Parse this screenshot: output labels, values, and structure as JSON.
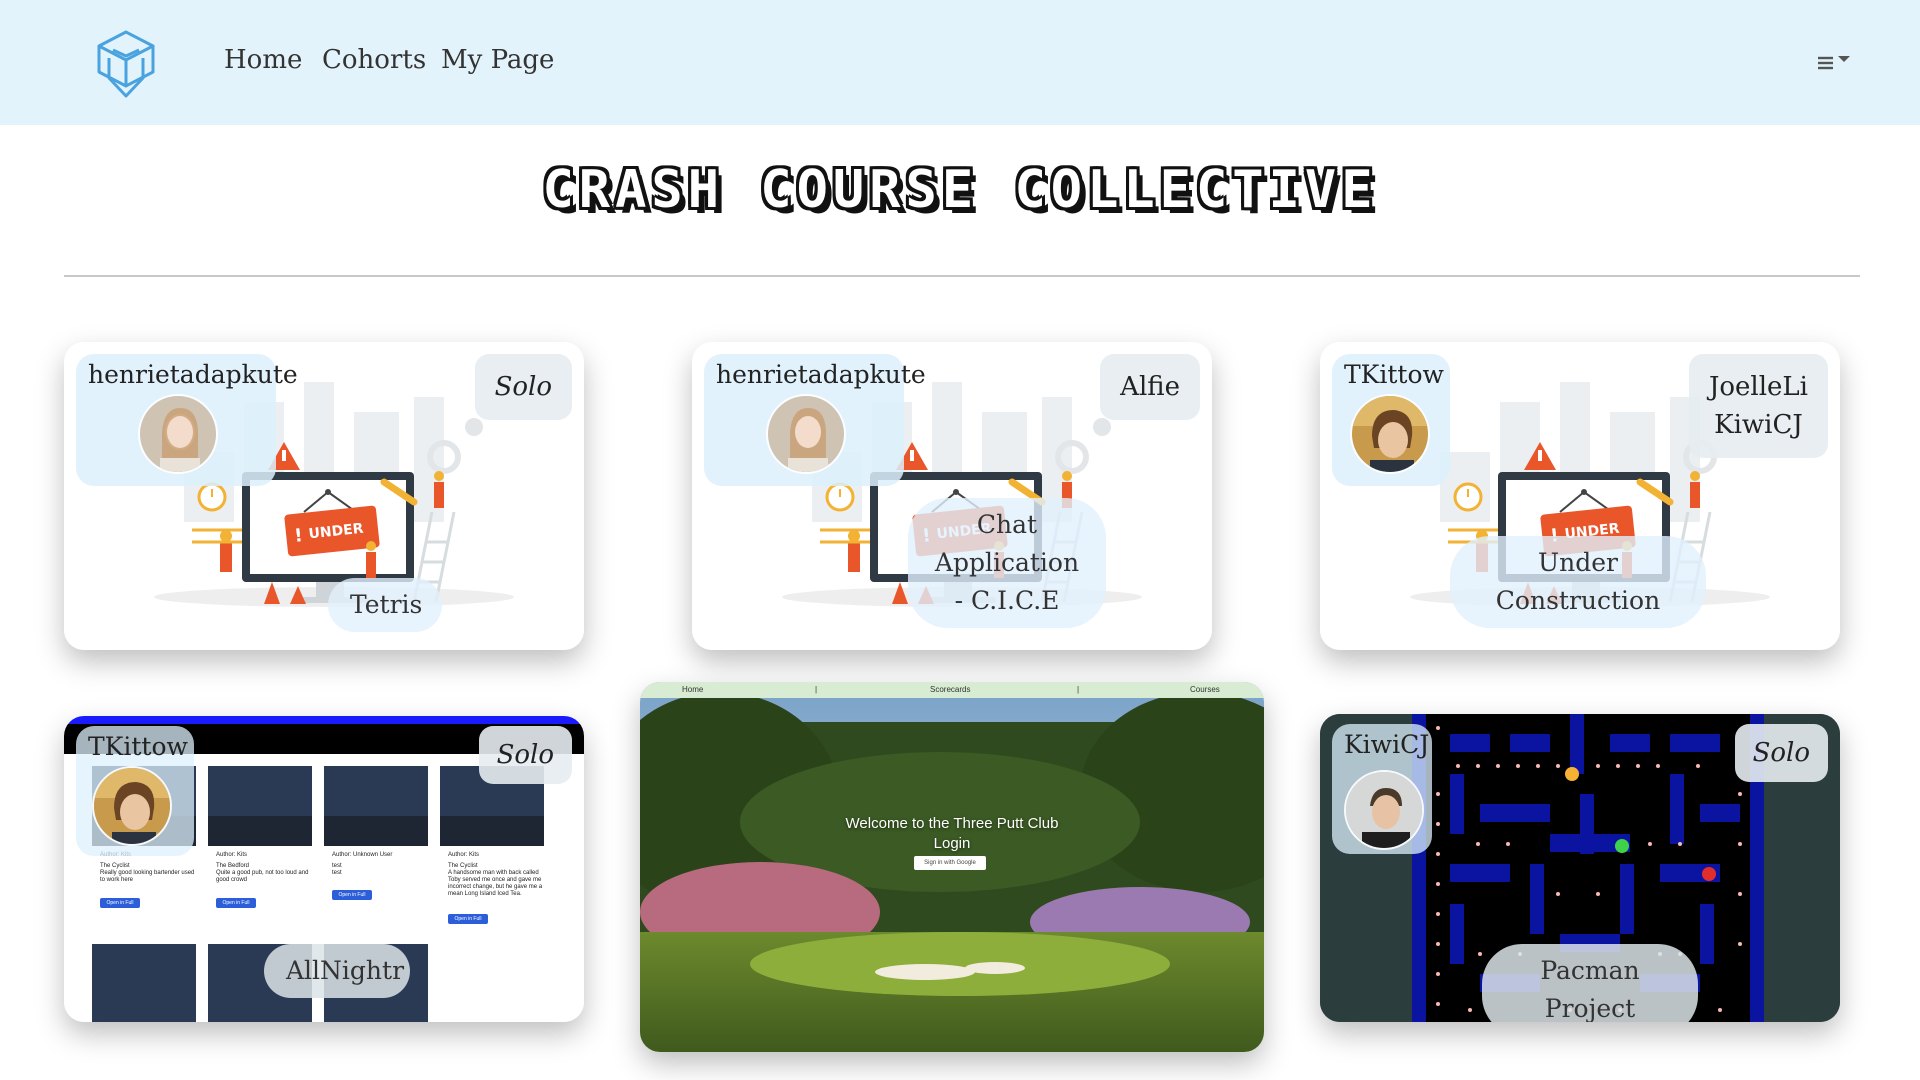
{
  "navbar": {
    "logo": "graduation-cube-logo",
    "links": [
      "Home",
      "Cohorts",
      "My Page"
    ],
    "menu_icon": "hamburger-icon",
    "background": "#e3f3fb"
  },
  "title": "CRASH COURSE COLLECTIVE",
  "cards": [
    {
      "author": "henrietadapkute",
      "partner": "Solo",
      "project": "Tetris",
      "thumbnail": "under-construction-illustration"
    },
    {
      "author": "henrietadapkute",
      "partner": "Alfie",
      "project": "Chat Application - C.I.C.E",
      "thumbnail": "under-construction-illustration"
    },
    {
      "author": "TKittow",
      "partners": [
        "JoelleLi",
        "KiwiCJ"
      ],
      "project": "Under Construction",
      "thumbnail": "under-construction-illustration"
    },
    {
      "author": "TKittow",
      "partner": "Solo",
      "project": "AllNightr",
      "thumbnail": "allnightr-screenshot",
      "thumb_posts": [
        {
          "author": "Author: Kits",
          "title": "The Cyclist",
          "body": "Really good looking bartender used to work here",
          "button": "Open in Full"
        },
        {
          "author": "Author: Kits",
          "title": "The Bedford",
          "body": "Quite a good pub, not too loud and good crowd",
          "button": "Open in Full"
        },
        {
          "author": "Author: Unknown User",
          "title": "test",
          "body": "test",
          "button": "Open in Full"
        },
        {
          "author": "Author: Kits",
          "title": "The Cyclist",
          "body": "A handsome man with back called Toby served me once and gave me incorrect change, but he gave me a mean Long Island Iced Tea.",
          "button": "Open in Full"
        }
      ]
    },
    {
      "thumbnail": "golf-course-screenshot",
      "thumb_nav": [
        "Home",
        "|",
        "Scorecards",
        "|",
        "Courses"
      ],
      "thumb_welcome": "Welcome to the Three Putt Club",
      "thumb_login": "Login",
      "thumb_signin": "Sign in with Google"
    },
    {
      "author": "KiwiCJ",
      "partner": "Solo",
      "project": "Pacman Project",
      "thumbnail": "pacman-maze-screenshot"
    }
  ]
}
